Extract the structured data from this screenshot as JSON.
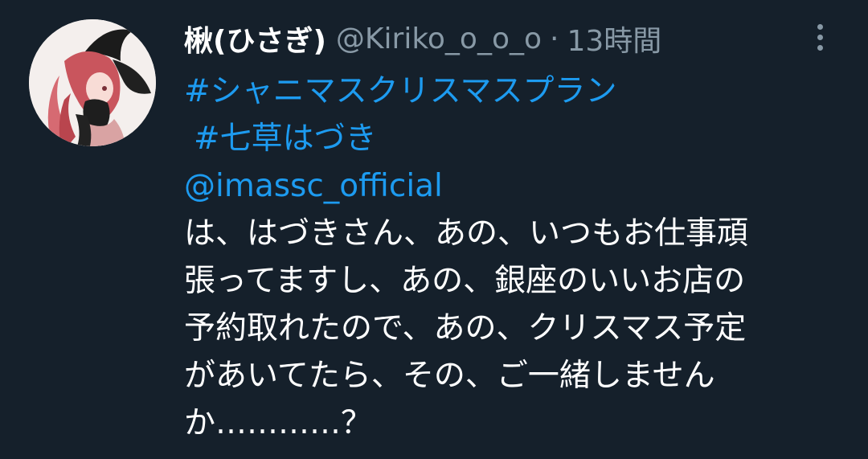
{
  "tweet": {
    "display_name": "楸(ひさぎ)",
    "handle": "@Kiriko_o_o_o",
    "separator": "·",
    "timestamp": "13時間",
    "more_icon": "more-vertical-icon",
    "hashtag_1": "#シャニマスクリスマスプラン",
    "hashtag_2": "#七草はづき",
    "mention": "@imassc_official",
    "text_lines": [
      "は、はづきさん、あの、いつもお仕事頑",
      "張ってますし、あの、銀座のいいお店の",
      "予約取れたので、あの、クリスマス予定",
      "があいてたら、その、ご一緒しません",
      "か…………？"
    ]
  },
  "colors": {
    "background": "#15202b",
    "link": "#1d9bf0",
    "secondary_text": "#8899a6",
    "primary_text": "#ffffff"
  }
}
